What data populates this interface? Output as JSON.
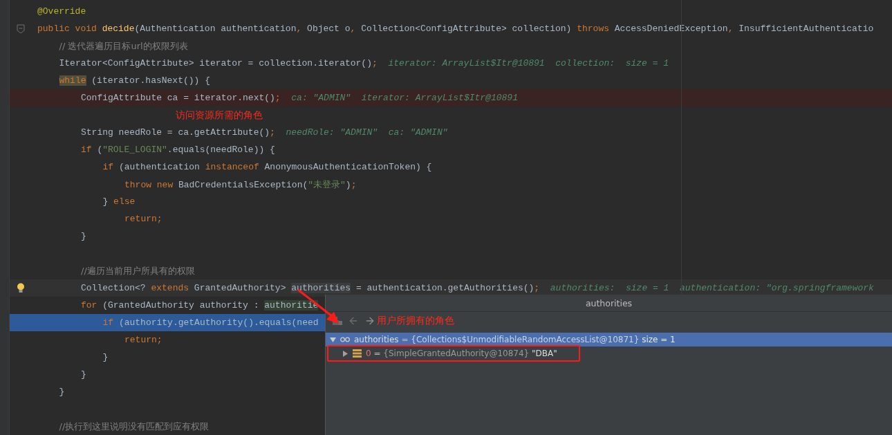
{
  "editor": {
    "lines": [
      {
        "kind": "normal",
        "tokens": [
          {
            "kind": "ann",
            "text": "@Override"
          }
        ]
      },
      {
        "kind": "normal",
        "gutter": {
          "kind": "fold"
        },
        "tokens": [
          {
            "kind": "kw",
            "text": "public void "
          },
          {
            "kind": "method",
            "text": "decide"
          },
          {
            "kind": "plain",
            "text": "(Authentication authentication"
          },
          {
            "kind": "kw",
            "text": ", "
          },
          {
            "kind": "plain",
            "text": "Object o"
          },
          {
            "kind": "kw",
            "text": ", "
          },
          {
            "kind": "plain",
            "text": "Collection<ConfigAttribute> collection) "
          },
          {
            "kind": "kw",
            "text": "throws "
          },
          {
            "kind": "plain",
            "text": "AccessDeniedException"
          },
          {
            "kind": "kw",
            "text": ", "
          },
          {
            "kind": "plain",
            "text": "InsufficientAuthenticatio"
          }
        ],
        "children": [
          {
            "kind": "normal",
            "tokens": [
              {
                "kind": "comment",
                "text": "// 迭代器遍历目标url的权限列表"
              }
            ]
          },
          {
            "kind": "normal",
            "tokens": [
              {
                "kind": "plain",
                "text": "Iterator<ConfigAttribute> iterator = collection.iterator()"
              },
              {
                "kind": "kw",
                "text": ";"
              },
              {
                "kind": "hint",
                "text": "  iterator: ArrayList$Itr@10891  collection:  size = 1"
              }
            ]
          },
          {
            "kind": "normal",
            "tokens": [
              {
                "kind": "kw_usage",
                "text": "while"
              },
              {
                "kind": "plain",
                "text": " (iterator.hasNext()) {"
              }
            ],
            "children": [
              {
                "kind": "breakpoint",
                "tokens": [
                  {
                    "kind": "plain",
                    "text": "ConfigAttribute ca = iterator.next()"
                  },
                  {
                    "kind": "kw",
                    "text": ";"
                  },
                  {
                    "kind": "hint",
                    "text": "  ca: \"ADMIN\"  iterator: ArrayList$Itr@10891"
                  }
                ]
              },
              {
                "kind": "note",
                "tokens": [
                  {
                    "kind": "note",
                    "text": "访问资源所需的角色"
                  }
                ]
              },
              {
                "kind": "normal",
                "tokens": [
                  {
                    "kind": "plain",
                    "text": "String needRole = ca.getAttribute()"
                  },
                  {
                    "kind": "kw",
                    "text": ";"
                  },
                  {
                    "kind": "hint",
                    "text": "  needRole: \"ADMIN\"  ca: \"ADMIN\""
                  }
                ]
              },
              {
                "kind": "normal",
                "tokens": [
                  {
                    "kind": "kw",
                    "text": "if "
                  },
                  {
                    "kind": "plain",
                    "text": "("
                  },
                  {
                    "kind": "str",
                    "text": "\"ROLE_LOGIN\""
                  },
                  {
                    "kind": "plain",
                    "text": ".equals(needRole)) {"
                  }
                ],
                "children": [
                  {
                    "kind": "normal",
                    "tokens": [
                      {
                        "kind": "kw",
                        "text": "if "
                      },
                      {
                        "kind": "plain",
                        "text": "(authentication "
                      },
                      {
                        "kind": "kw",
                        "text": "instanceof "
                      },
                      {
                        "kind": "plain",
                        "text": "AnonymousAuthenticationToken) {"
                      }
                    ],
                    "children": [
                      {
                        "kind": "normal",
                        "tokens": [
                          {
                            "kind": "kw",
                            "text": "throw new "
                          },
                          {
                            "kind": "plain",
                            "text": "BadCredentialsException("
                          },
                          {
                            "kind": "str",
                            "text": "\"未登录\""
                          },
                          {
                            "kind": "plain",
                            "text": ")"
                          },
                          {
                            "kind": "kw",
                            "text": ";"
                          }
                        ]
                      }
                    ]
                  },
                  {
                    "kind": "normal",
                    "tokens": [
                      {
                        "kind": "plain",
                        "text": "} "
                      },
                      {
                        "kind": "kw",
                        "text": "else"
                      }
                    ],
                    "children": [
                      {
                        "kind": "normal",
                        "tokens": [
                          {
                            "kind": "kw",
                            "text": "return;"
                          }
                        ]
                      }
                    ]
                  }
                ]
              },
              {
                "kind": "normal",
                "tokens": [
                  {
                    "kind": "plain",
                    "text": "}"
                  }
                ]
              },
              {
                "kind": "blank"
              },
              {
                "kind": "normal",
                "tokens": [
                  {
                    "kind": "comment",
                    "text": "//遍历当前用户所具有的权限"
                  }
                ]
              },
              {
                "kind": "caret",
                "gutter": {
                  "kind": "bulb"
                },
                "tokens": [
                  {
                    "kind": "plain",
                    "text": "Collection<? "
                  },
                  {
                    "kind": "kw",
                    "text": "extends "
                  },
                  {
                    "kind": "plain",
                    "text": "GrantedAuthority> "
                  },
                  {
                    "kind": "ident_usage",
                    "text": "authorities"
                  },
                  {
                    "kind": "plain",
                    "text": " = authentication.getAuthorities()"
                  },
                  {
                    "kind": "kw",
                    "text": ";"
                  },
                  {
                    "kind": "hint",
                    "text": "  authorities:  size = 1  authentication: \"org.springframework"
                  }
                ]
              },
              {
                "kind": "normal",
                "tokens": [
                  {
                    "kind": "kw",
                    "text": "for "
                  },
                  {
                    "kind": "plain",
                    "text": "(GrantedAuthority authority : "
                  },
                  {
                    "kind": "ident_write",
                    "text": "authoritie"
                  }
                ],
                "children": [
                  {
                    "kind": "current",
                    "tokens": [
                      {
                        "kind": "kw",
                        "text": "if "
                      },
                      {
                        "kind": "plain",
                        "text": "(authority.getAuthority().equals(need"
                      }
                    ],
                    "children": [
                      {
                        "kind": "normal",
                        "tokens": [
                          {
                            "kind": "kw",
                            "text": "return;"
                          }
                        ]
                      }
                    ]
                  },
                  {
                    "kind": "normal",
                    "tokens": [
                      {
                        "kind": "plain",
                        "text": "}"
                      }
                    ]
                  }
                ]
              },
              {
                "kind": "normal",
                "tokens": [
                  {
                    "kind": "plain",
                    "text": "}"
                  }
                ]
              }
            ]
          },
          {
            "kind": "normal",
            "tokens": [
              {
                "kind": "plain",
                "text": "}"
              }
            ]
          },
          {
            "kind": "blank"
          },
          {
            "kind": "normal",
            "tokens": [
              {
                "kind": "comment",
                "text": "//执行到这里说明没有匹配到应有权限"
              }
            ]
          }
        ]
      }
    ]
  },
  "popup": {
    "title": "authorities",
    "note": "用户所拥有的角色",
    "tree": [
      {
        "name": "authorities",
        "equals": "=",
        "value": "{Collections$UnmodifiableRandomAccessList@10871}",
        "extra": "size = 1",
        "expanded": true,
        "selected": true,
        "children": [
          {
            "name": "0",
            "equals": "=",
            "value": "{SimpleGrantedAuthority@10874}",
            "extra": "\"DBA\"",
            "expanded": false,
            "selected": false
          }
        ]
      }
    ]
  }
}
